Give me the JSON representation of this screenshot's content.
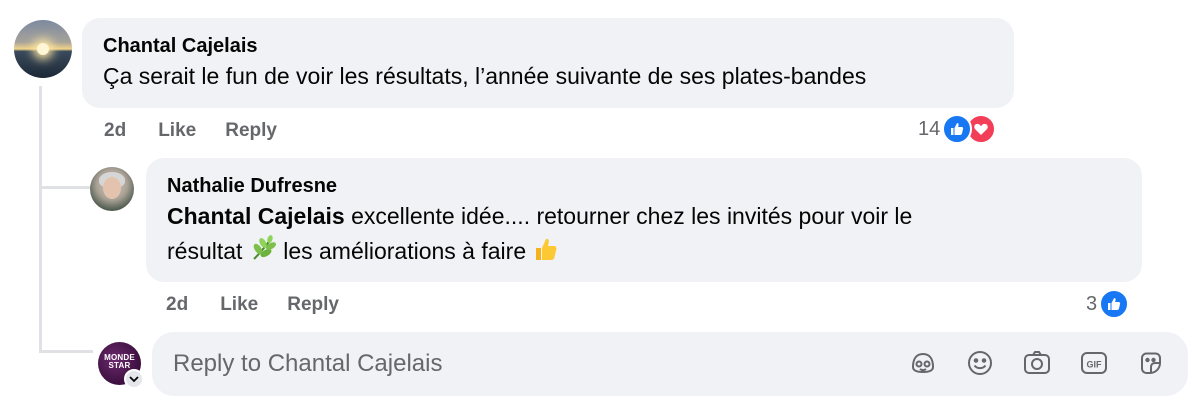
{
  "comment": {
    "author": "Chantal Cajelais",
    "text": "Ça serait le fun de voir les résultats, l’année suivante de ses plates-bandes",
    "time": "2d",
    "like_label": "Like",
    "reply_label": "Reply",
    "reaction_count": "14",
    "reactions": [
      "like-icon",
      "love-icon"
    ]
  },
  "reply": {
    "author": "Nathalie Dufresne",
    "mention": "Chantal Cajelais",
    "text_part1": " excellente idée.... retourner chez les invités pour voir le",
    "text_part2": "résultat",
    "text_part3": " les améliorations à faire",
    "emoji1": "herb-emoji",
    "emoji2": "thumbs-up-emoji",
    "time": "2d",
    "like_label": "Like",
    "reply_label": "Reply",
    "reaction_count": "3",
    "reactions": [
      "like-icon"
    ]
  },
  "composer": {
    "placeholder": "Reply to Chantal Cajelais",
    "avatar_text_line1": "MONDE",
    "avatar_text_line2": "STAR",
    "tools": [
      "avatar-sticker-icon",
      "emoji-icon",
      "camera-icon",
      "gif-icon",
      "sticker-icon"
    ]
  },
  "colors": {
    "bubble": "#f0f2f5",
    "meta": "#65676b",
    "like": "#1877f2",
    "love": "#f33e58"
  }
}
